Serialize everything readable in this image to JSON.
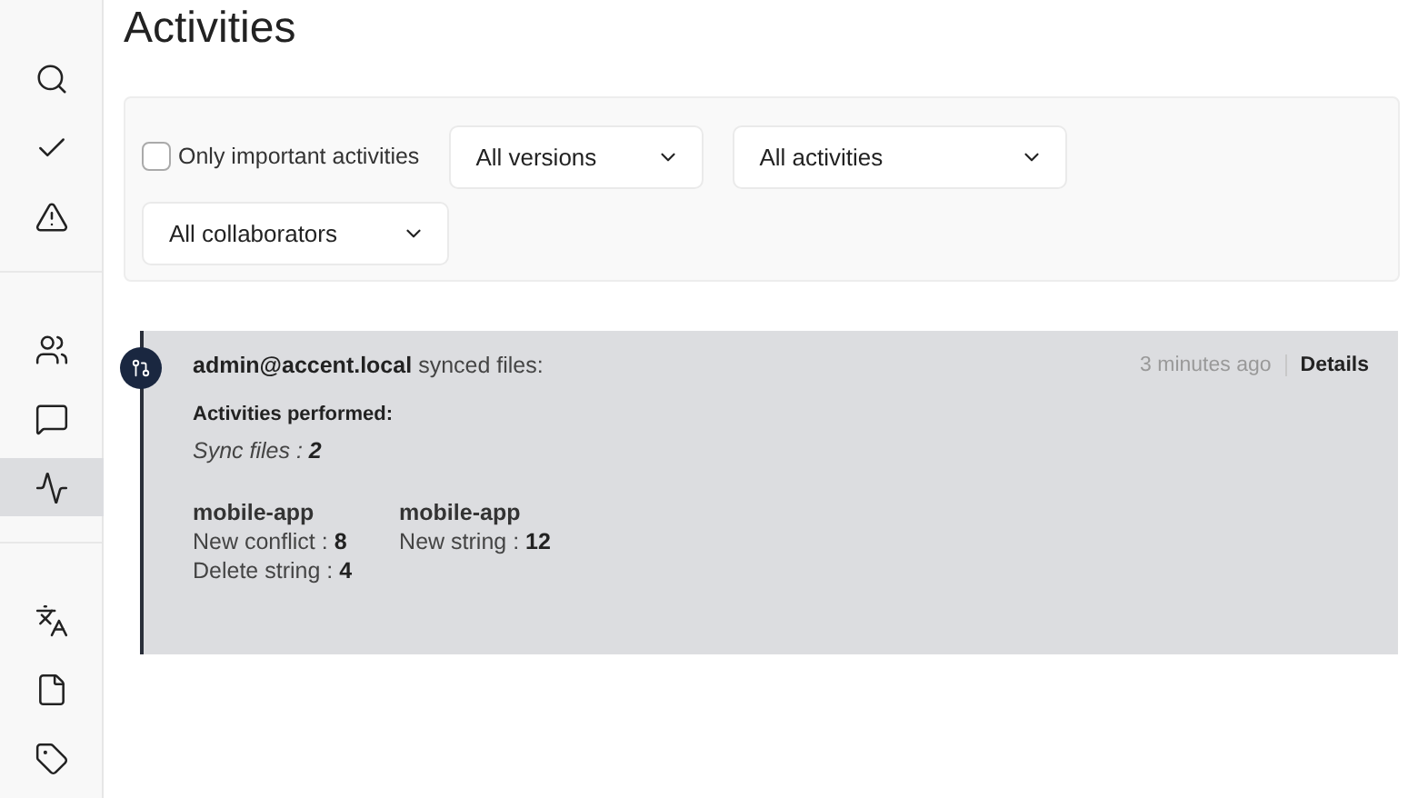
{
  "sidebar": {
    "sections": [
      {
        "items": [
          {
            "kind": "search",
            "selected": false
          },
          {
            "kind": "check",
            "selected": false
          },
          {
            "kind": "warning",
            "selected": false
          }
        ]
      },
      {
        "items": [
          {
            "kind": "users",
            "selected": false
          },
          {
            "kind": "message",
            "selected": false
          },
          {
            "kind": "activity",
            "selected": true
          }
        ]
      },
      {
        "items": [
          {
            "kind": "translate",
            "selected": false
          },
          {
            "kind": "file",
            "selected": false
          },
          {
            "kind": "tag",
            "selected": false
          }
        ]
      }
    ]
  },
  "page": {
    "title": "Activities"
  },
  "filters": {
    "checkbox": {
      "label": "Only important activities",
      "checked": false
    },
    "selects": [
      {
        "value": "All versions"
      },
      {
        "value": "All activities"
      },
      {
        "value": "All collaborators"
      }
    ]
  },
  "activities": [
    {
      "user": "admin@accent.local",
      "action": "synced files:",
      "time": "3 minutes ago",
      "details": "Details",
      "performed_title": "Activities performed:",
      "summary": [
        {
          "label": "Sync files : ",
          "count": "2"
        }
      ],
      "groups": [
        {
          "project": "mobile-app",
          "stats": [
            {
              "label": "New conflict : ",
              "count": "8"
            },
            {
              "label": "Delete string : ",
              "count": "4"
            }
          ]
        },
        {
          "project": "mobile-app",
          "stats": [
            {
              "label": "New string : ",
              "count": "12"
            }
          ]
        }
      ]
    }
  ]
}
